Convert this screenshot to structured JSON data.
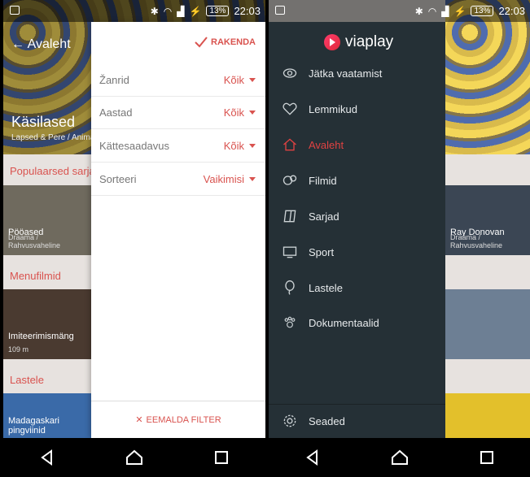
{
  "left": {
    "status": {
      "time": "22:03",
      "battery": "13%"
    },
    "background": {
      "hero_back": "← Avaleht",
      "hero_title": "Käsilased",
      "hero_sub": "Lapsed & Pere / Animatsioon",
      "sections": [
        {
          "title": "Populaarsed sarjad",
          "tile_title": "Pööased",
          "tile_sub": "Draama / Rahvusvaheline"
        },
        {
          "title": "Menufilmid",
          "tile_title": "Imiteerimismäng",
          "tile_sub": "109 m"
        },
        {
          "title": "Lastele",
          "tile_title": "Madagaskari pingviinid",
          "tile_sub": ""
        }
      ]
    },
    "filter": {
      "apply_label": "RAKENDA",
      "rows": [
        {
          "label": "Žanrid",
          "value": "Kõik"
        },
        {
          "label": "Aastad",
          "value": "Kõik"
        },
        {
          "label": "Kättesaadavus",
          "value": "Kõik"
        },
        {
          "label": "Sorteeri",
          "value": "Vaikimisi"
        }
      ],
      "remove_label": "EEMALDA FILTER"
    },
    "accent": "#d9534f"
  },
  "right": {
    "status": {
      "time": "22:03",
      "battery": "13%"
    },
    "logo_text": "viaplay",
    "menu": [
      {
        "label": "Jätka vaatamist",
        "icon": "eye-icon",
        "active": false
      },
      {
        "label": "Lemmikud",
        "icon": "heart-icon",
        "active": false
      },
      {
        "label": "Avaleht",
        "icon": "home-icon",
        "active": true
      },
      {
        "label": "Filmid",
        "icon": "film-reel-icon",
        "active": false
      },
      {
        "label": "Sarjad",
        "icon": "tv-series-icon",
        "active": false
      },
      {
        "label": "Sport",
        "icon": "monitor-icon",
        "active": false
      },
      {
        "label": "Lastele",
        "icon": "balloon-icon",
        "active": false
      },
      {
        "label": "Dokumentaalid",
        "icon": "paw-icon",
        "active": false
      }
    ],
    "settings_label": "Seaded",
    "background": {
      "tile_title": "Ray Donovan",
      "tile_sub": "Draama / Rahvusvaheline"
    },
    "active_color": "#e04242"
  }
}
